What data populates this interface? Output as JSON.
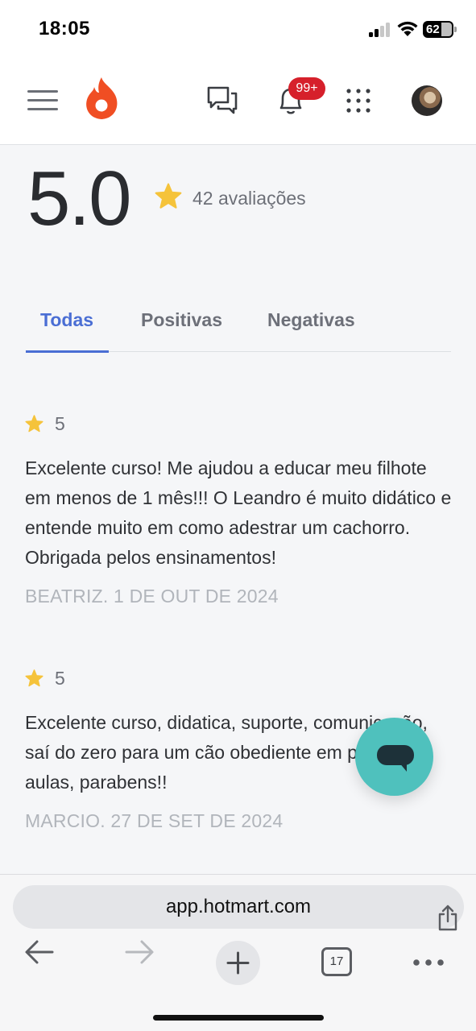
{
  "status_bar": {
    "time": "18:05",
    "battery": "62"
  },
  "header": {
    "notification_badge": "99+",
    "icons": [
      "menu-icon",
      "hotmart-logo",
      "chat-icon",
      "bell-icon",
      "apps-grid-icon",
      "avatar"
    ]
  },
  "rating": {
    "score": "5.0",
    "count_label": "42 avaliações"
  },
  "tabs": [
    {
      "label": "Todas",
      "active": true
    },
    {
      "label": "Positivas",
      "active": false
    },
    {
      "label": "Negativas",
      "active": false
    }
  ],
  "reviews": [
    {
      "score": "5",
      "text": "Excelente curso! Me ajudou a educar meu filhote em menos de 1 mês!!! O Leandro é muito didático e entende muito em como adestrar um cachorro. Obrigada pelos ensinamentos!",
      "meta": "BEATRIZ. 1 DE OUT DE 2024"
    },
    {
      "score": "5",
      "text": "Excelente curso, didatica, suporte, comunicação, saí do zero para um cão obediente em poucas aulas, parabens!!",
      "meta": "MARCIO. 27 DE SET DE 2024"
    }
  ],
  "browser": {
    "url": "app.hotmart.com",
    "tab_count": "17"
  },
  "colors": {
    "accent": "#4a6ed4",
    "star": "#f5c33b",
    "logo": "#f04e23",
    "badge": "#d6202b",
    "fab": "#4fc1bd"
  }
}
